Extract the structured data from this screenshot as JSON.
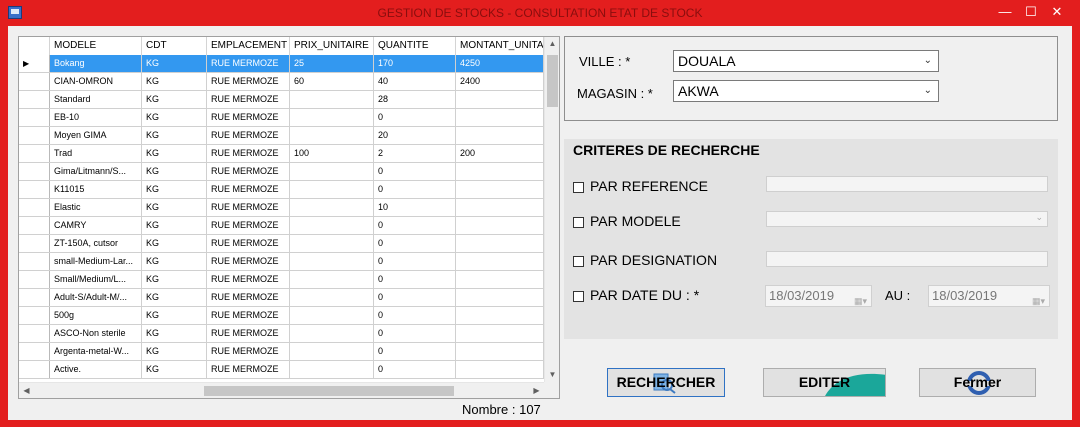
{
  "window": {
    "title": "GESTION DE STOCKS - CONSULTATION ETAT DE STOCK",
    "minimize_glyph": "—",
    "maximize_glyph": "☐",
    "close_glyph": "✕"
  },
  "grid": {
    "columns": [
      "MODELE",
      "CDT",
      "EMPLACEMENT",
      "PRIX_UNITAIRE",
      "QUANTITE",
      "MONTANT_UNITA"
    ],
    "current_row_glyph": "▶",
    "rows": [
      [
        "Bokang",
        "KG",
        "RUE MERMOZE",
        "25",
        "170",
        "4250"
      ],
      [
        "CIAN-OMRON",
        "KG",
        "RUE MERMOZE",
        "60",
        "40",
        "2400"
      ],
      [
        "Standard",
        "KG",
        "RUE MERMOZE",
        "",
        "28",
        ""
      ],
      [
        "EB-10",
        "KG",
        "RUE MERMOZE",
        "",
        "0",
        ""
      ],
      [
        "Moyen GIMA",
        "KG",
        "RUE MERMOZE",
        "",
        "20",
        ""
      ],
      [
        "Trad",
        "KG",
        "RUE MERMOZE",
        "100",
        "2",
        "200"
      ],
      [
        "Gima/Litmann/S...",
        "KG",
        "RUE MERMOZE",
        "",
        "0",
        ""
      ],
      [
        "K11015",
        "KG",
        "RUE MERMOZE",
        "",
        "0",
        ""
      ],
      [
        "Elastic",
        "KG",
        "RUE MERMOZE",
        "",
        "10",
        ""
      ],
      [
        "CAMRY",
        "KG",
        "RUE MERMOZE",
        "",
        "0",
        ""
      ],
      [
        "ZT-150A, cutsor",
        "KG",
        "RUE MERMOZE",
        "",
        "0",
        ""
      ],
      [
        "small-Medium-Lar...",
        "KG",
        "RUE MERMOZE",
        "",
        "0",
        ""
      ],
      [
        "Small/Medium/L...",
        "KG",
        "RUE MERMOZE",
        "",
        "0",
        ""
      ],
      [
        "Adult-S/Adult-M/...",
        "KG",
        "RUE MERMOZE",
        "",
        "0",
        ""
      ],
      [
        "500g",
        "KG",
        "RUE MERMOZE",
        "",
        "0",
        ""
      ],
      [
        "ASCO-Non sterile",
        "KG",
        "RUE MERMOZE",
        "",
        "0",
        ""
      ],
      [
        "Argenta-metal-W...",
        "KG",
        "RUE MERMOZE",
        "",
        "0",
        ""
      ],
      [
        "Active.",
        "KG",
        "RUE MERMOZE",
        "",
        "0",
        ""
      ]
    ]
  },
  "footer": {
    "count_label": "Nombre :",
    "count_value": "107"
  },
  "location": {
    "ville_label": "VILLE : *",
    "ville_value": "DOUALA",
    "magasin_label": "MAGASIN : *",
    "magasin_value": "AKWA"
  },
  "criteria": {
    "title": "CRITERES DE RECHERCHE",
    "par_reference": "PAR REFERENCE",
    "par_modele": "PAR MODELE",
    "par_designation": "PAR DESIGNATION",
    "par_date_du": "PAR DATE DU : *",
    "date_from": "18/03/2019",
    "au_label": "AU :",
    "date_to": "18/03/2019"
  },
  "buttons": {
    "rechercher": "RECHERCHER",
    "editer": "EDITER",
    "fermer": "Fermer"
  }
}
